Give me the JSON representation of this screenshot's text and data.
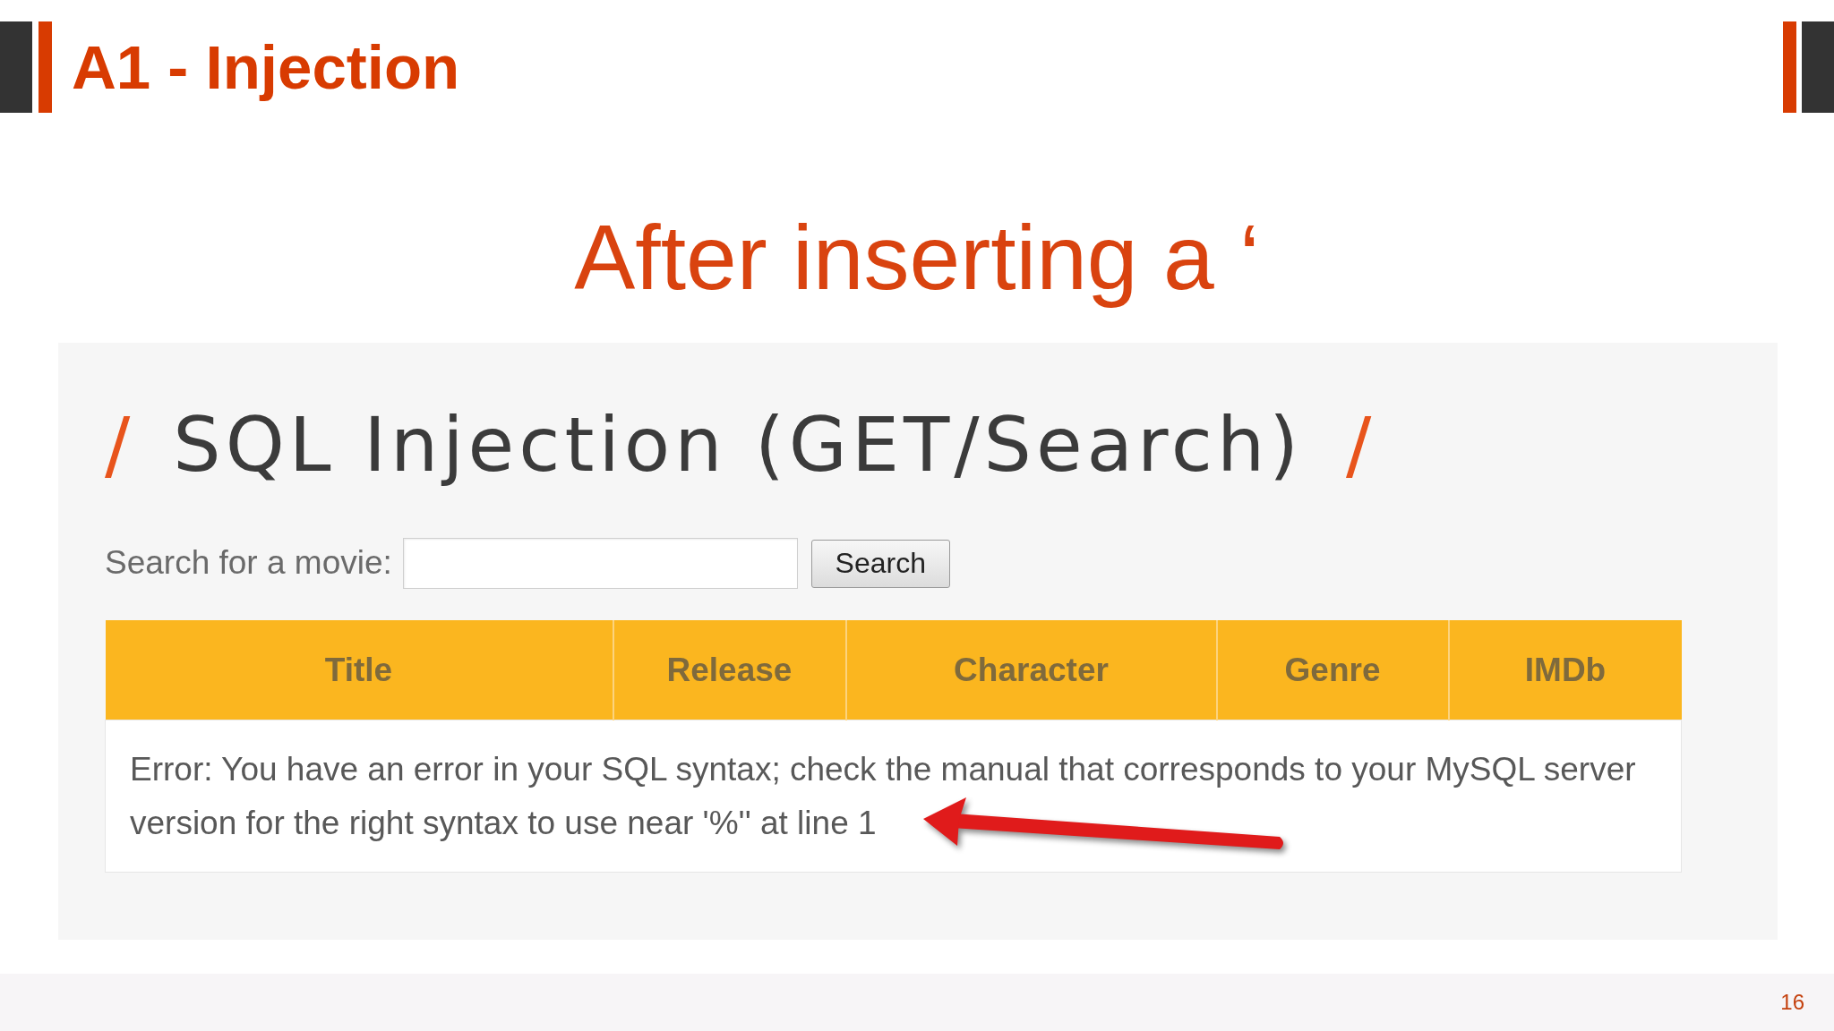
{
  "header": {
    "title": "A1 - Injection"
  },
  "subtitle": "After inserting a ‘",
  "screenshot": {
    "heading": {
      "prefix": "/",
      "text": "SQL Injection (GET/Search)",
      "suffix": "/"
    },
    "search": {
      "label": "Search for a movie:",
      "button": "Search"
    },
    "table": {
      "columns": [
        "Title",
        "Release",
        "Character",
        "Genre",
        "IMDb"
      ],
      "rows": [
        {
          "kind": "error",
          "text": "Error: You have an error in your SQL syntax; check the manual that corresponds to your MySQL server version for the right syntax to use near '%'' at line 1"
        }
      ]
    }
  },
  "footer": {
    "page_number": "16"
  }
}
